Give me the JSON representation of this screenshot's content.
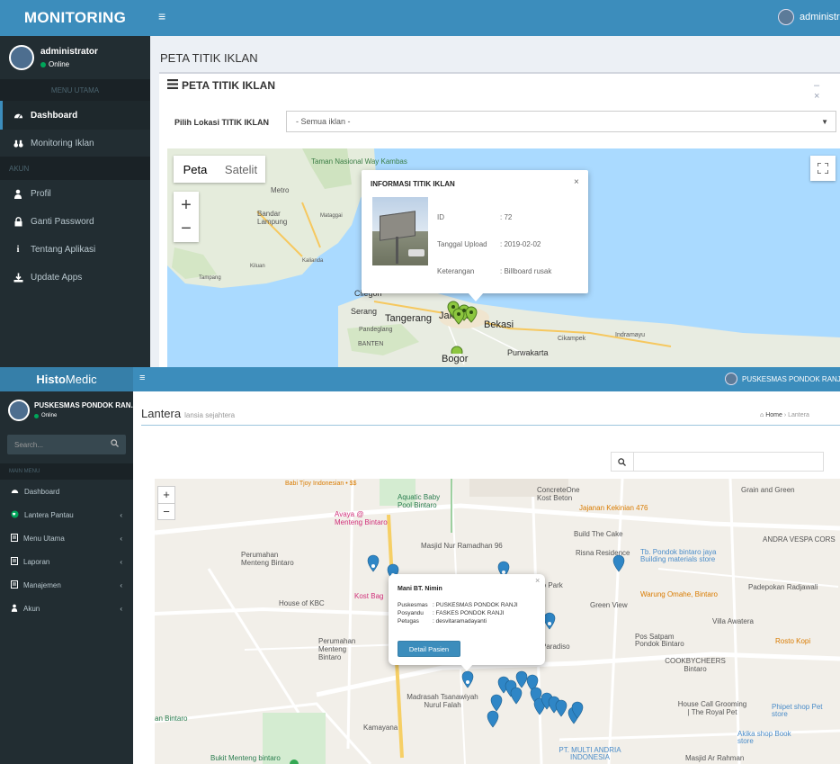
{
  "monitoring": {
    "brand": "MONITORING",
    "menu_toggle_glyph": "≡",
    "header_user": "administrat",
    "user": {
      "name": "administrator",
      "status": "Online"
    },
    "section_main": "MENU UTAMA",
    "nav_main": [
      {
        "label": "Dashboard",
        "icon": "dashboard-icon",
        "active": true
      },
      {
        "label": "Monitoring Iklan",
        "icon": "binoculars-icon",
        "active": false
      }
    ],
    "section_account": "AKUN",
    "nav_account": [
      {
        "label": "Profil",
        "icon": "user-icon"
      },
      {
        "label": "Ganti Password",
        "icon": "lock-icon"
      },
      {
        "label": "Tentang Aplikasi",
        "icon": "info-icon"
      },
      {
        "label": "Update Apps",
        "icon": "download-icon"
      }
    ],
    "page_title": "PETA TITIK IKLAN",
    "box_title": "PETA TITIK IKLAN",
    "box_tools": "– ×",
    "filter": {
      "label": "Pilih Lokasi TITIK IKLAN",
      "value": "- Semua iklan -"
    },
    "map": {
      "type_buttons": [
        "Peta",
        "Satelit"
      ],
      "zoom_in": "+",
      "zoom_out": "−",
      "fullscreen_glyph": "⛶",
      "places": [
        {
          "name": "Taman Nasional Way Kambas"
        },
        {
          "name": "Metro"
        },
        {
          "name": "Bandar Lampung"
        },
        {
          "name": "Mataggai"
        },
        {
          "name": "Kalianda"
        },
        {
          "name": "Kiluan"
        },
        {
          "name": "Tampang"
        },
        {
          "name": "Cilegon"
        },
        {
          "name": "Serang"
        },
        {
          "name": "Tangerang"
        },
        {
          "name": "Jakarta"
        },
        {
          "name": "Bekasi"
        },
        {
          "name": "Pandeglang"
        },
        {
          "name": "BANTEN"
        },
        {
          "name": "Cikampek"
        },
        {
          "name": "Purwakarta"
        },
        {
          "name": "Indramayu"
        },
        {
          "name": "Bogor"
        }
      ],
      "info_window": {
        "title": "INFORMASI TITIK IKLAN",
        "close": "×",
        "rows": [
          {
            "label": "ID",
            "value": ": 72"
          },
          {
            "label": "Tanggal Upload",
            "value": ": 2019-02-02"
          },
          {
            "label": "Keterangan",
            "value": ": Billboard rusak"
          }
        ]
      }
    }
  },
  "histomedic": {
    "brand_bold": "Histo",
    "brand_light": "Medic",
    "menu_toggle_glyph": "≡",
    "header_user": "PUSKESMAS PONDOK RANJI",
    "user": {
      "name": "PUSKESMAS PONDOK RAN.",
      "status": "Online"
    },
    "search_placeholder": "Search...",
    "section_main": "MAIN MENU",
    "nav": [
      {
        "label": "Dashboard",
        "icon": "dashboard-icon",
        "has_children": false
      },
      {
        "label": "Lantera Pantau",
        "icon": "globe-icon",
        "has_children": true
      },
      {
        "label": "Menu Utama",
        "icon": "book-icon",
        "has_children": true
      },
      {
        "label": "Laporan",
        "icon": "book-icon",
        "has_children": true
      },
      {
        "label": "Manajemen",
        "icon": "book-icon",
        "has_children": true
      },
      {
        "label": "Akun",
        "icon": "user-icon",
        "has_children": true
      }
    ],
    "page_title": "Lantera",
    "page_subtitle": "lansia sejahtera",
    "breadcrumb": {
      "home": "Home",
      "sep": "›",
      "current": "Lantera"
    },
    "map": {
      "zoom_in": "+",
      "zoom_out": "−",
      "places": [
        {
          "name": "Babi Tjoy Indonesian • $$"
        },
        {
          "name": "Aquatic Baby Pool Bintaro"
        },
        {
          "name": "ConcreteOne Kost Beton"
        },
        {
          "name": "Jajanan Kekinian 476"
        },
        {
          "name": "Grain and Green"
        },
        {
          "name": "Avaya @ Menteng Bintaro"
        },
        {
          "name": "Masjid Nur Ramadhan 96"
        },
        {
          "name": "Build The Cake"
        },
        {
          "name": "Risna Residence"
        },
        {
          "name": "Tb. Pondok bintaro jaya Building materials store"
        },
        {
          "name": "ANDRA VESPA CORS"
        },
        {
          "name": "Perumahan Menteng Bintaro"
        },
        {
          "name": "Padepokan Radjawali"
        },
        {
          "name": "House of KBC"
        },
        {
          "name": "Kost Bag"
        },
        {
          "name": "ro Park"
        },
        {
          "name": "Warung Omahe, Bintaro"
        },
        {
          "name": "Green View"
        },
        {
          "name": "Villa Awatera"
        },
        {
          "name": "Perumahan Menteng Bintaro"
        },
        {
          "name": "Paradiso"
        },
        {
          "name": "Pos Satpam Pondok Bintaro"
        },
        {
          "name": "Rosto Kopi"
        },
        {
          "name": "COOKBYCHEERS Bintaro"
        },
        {
          "name": "Madrasah Tsanawiyah Nurul Falah"
        },
        {
          "name": "House Call Grooming | The Royal Pet"
        },
        {
          "name": "Phipet shop Pet store"
        },
        {
          "name": "an Bintaro"
        },
        {
          "name": "Kamayana"
        },
        {
          "name": "Akika shop Book store"
        },
        {
          "name": "Bukit Menteng bintaro"
        },
        {
          "name": "PT. MULTI ANDRIA INDONESIA"
        },
        {
          "name": "Masjid Ar Rahman"
        }
      ],
      "info_window": {
        "name": "Mani BT. Nimin",
        "close": "×",
        "rows": [
          {
            "label": "Puskesmas",
            "value": ":  PUSKESMAS PONDOK RANJI"
          },
          {
            "label": "Posyandu",
            "value": ":  FASKES PONDOK RANJI"
          },
          {
            "label": "Petugas",
            "value": ":  desvitaramadayanti"
          }
        ],
        "button": "Detail Pasien"
      }
    }
  }
}
